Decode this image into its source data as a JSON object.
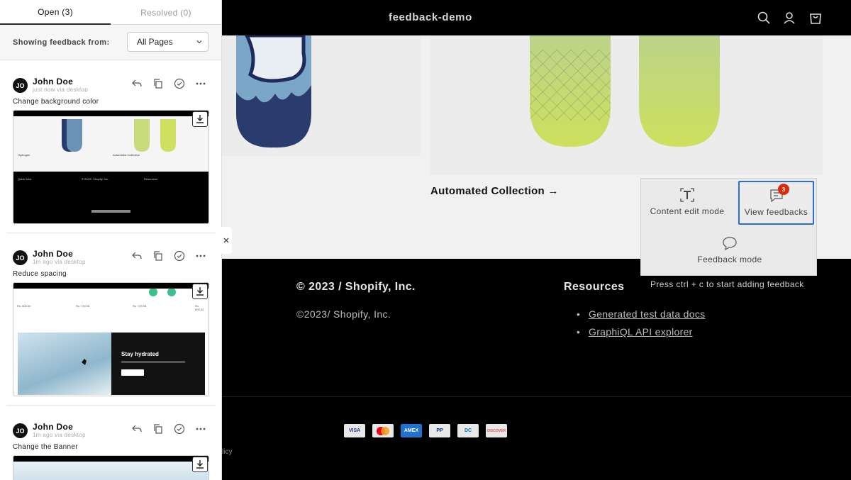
{
  "store": {
    "title": "feedback-demo",
    "collection_link": "Automated Collection",
    "footer": {
      "copyright_heading": "© 2023 / Shopify, Inc.",
      "copyright_text": "©2023/ Shopify, Inc.",
      "resources_heading": "Resources",
      "resources": [
        "Generated test data docs",
        "GraphiQL API explorer"
      ],
      "payments": [
        "VISA",
        "MC",
        "AMEX",
        "PP",
        "DC",
        "DISCOVER"
      ],
      "policy_fragment": "licy"
    }
  },
  "toolbar": {
    "content_edit_label": "Content edit mode",
    "view_feedbacks_label": "View feedbacks",
    "feedback_count": "3",
    "feedback_mode_label": "Feedback mode",
    "hint": "Press ctrl + c to start adding feedback"
  },
  "panel": {
    "tabs": {
      "open": "Open (3)",
      "resolved": "Resolved (0)"
    },
    "filter_label": "Showing feedback from:",
    "filter_value": "All Pages",
    "items": [
      {
        "initials": "JO",
        "name": "John Doe",
        "meta": "just now via desktop",
        "text": "Change background color",
        "shot_labels": {
          "left": "Hydrogen",
          "right": "Automated Collection",
          "quick": "Quick links",
          "copy": "© 2023 / Shopify, Inc.",
          "res": "Resources"
        }
      },
      {
        "initials": "JO",
        "name": "John Doe",
        "meta": "1m ago via desktop",
        "text": "Reduce spacing",
        "shot_labels": {
          "banner": "Stay hydrated",
          "price1": "Rs. 600.00",
          "price2": "Rs. 749.95",
          "price3": "Rs. 729.95",
          "price4": "Rs. 600.00"
        }
      },
      {
        "initials": "JO",
        "name": "John Doe",
        "meta": "1m ago via desktop",
        "text": "Change the Banner"
      }
    ]
  },
  "colors": {
    "accent": "#2c6ecb",
    "badge": "#d72c0d",
    "board_navy": "#1f2a5c",
    "board_green": "#c8dc6a"
  }
}
